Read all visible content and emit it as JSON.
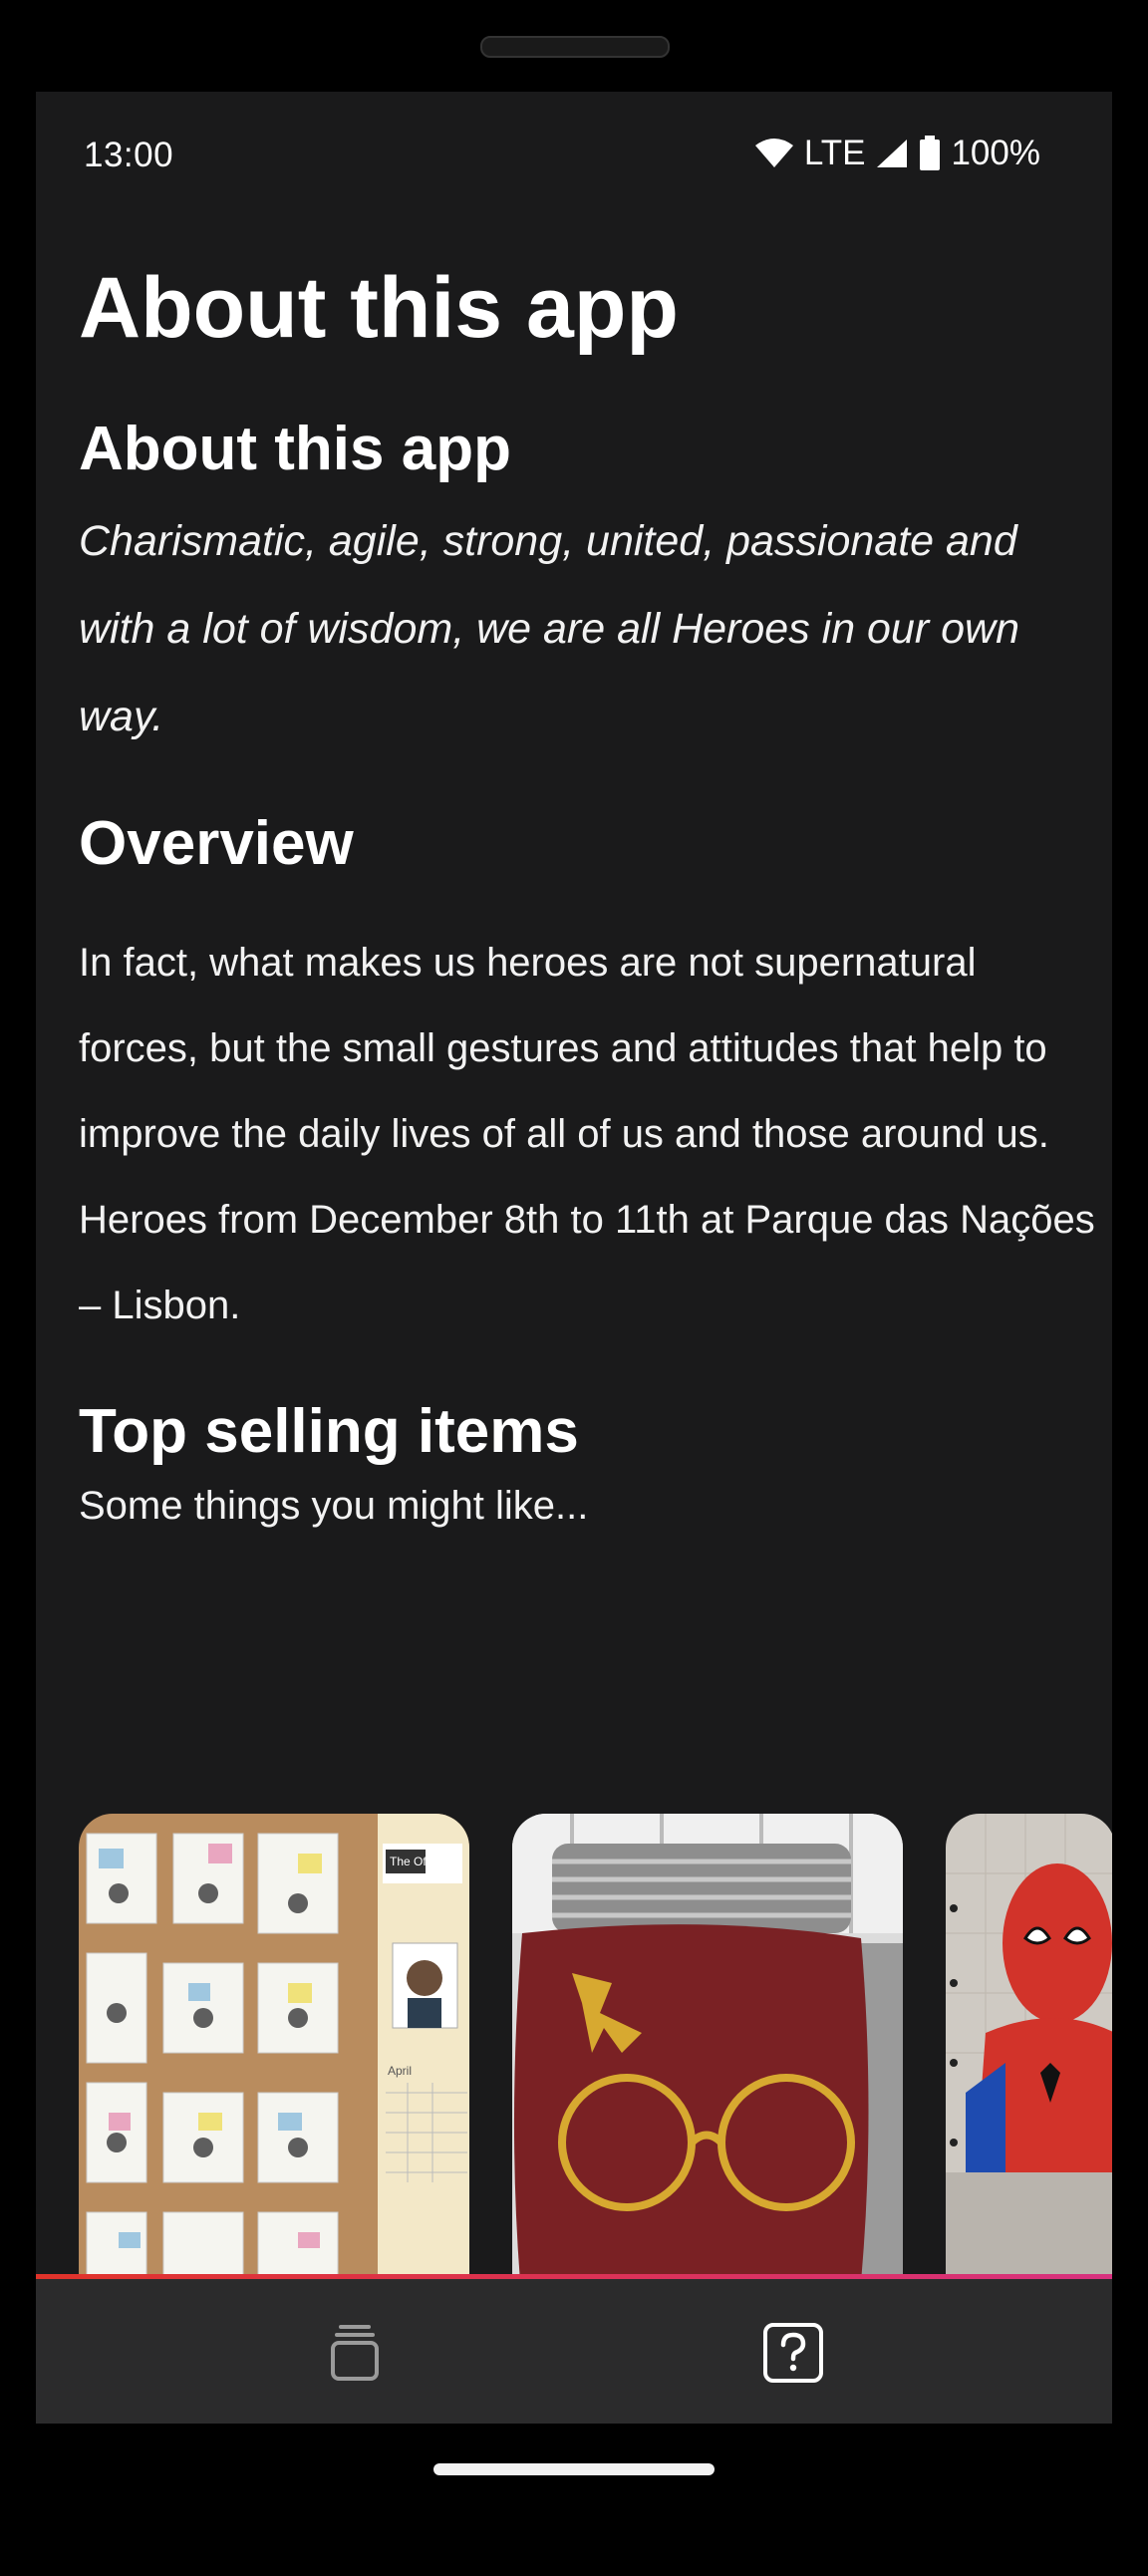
{
  "status_bar": {
    "time": "13:00",
    "network": "LTE",
    "battery": "100%"
  },
  "page": {
    "title": "About this app"
  },
  "about": {
    "heading": "About this app",
    "tagline": "Charismatic, agile, strong, united, passionate and with a lot of wisdom, we are all Heroes in our own way."
  },
  "overview": {
    "heading": "Overview",
    "body": "In fact, what makes us heroes are not supernatural forces, but the small gestures and attitudes that help to improve the daily lives of all of us and those around us. Heroes from December 8th to 11th at Parque das Nações – Lisbon."
  },
  "top_selling": {
    "heading": "Top selling items",
    "subtitle": "Some things you might like...",
    "items": [
      {
        "image": "the-office-calendar",
        "text": "The Office",
        "month": "April"
      },
      {
        "image": "harry-potter-glasses-pillow"
      },
      {
        "image": "spider-man-artwork"
      }
    ]
  },
  "nav": {
    "items": [
      {
        "icon": "collections-icon"
      },
      {
        "icon": "help-icon"
      }
    ]
  },
  "colors": {
    "background": "#1a1a1b",
    "nav_background": "#2b2b2c",
    "accent_start": "#e0332a",
    "accent_end": "#d8317f"
  }
}
